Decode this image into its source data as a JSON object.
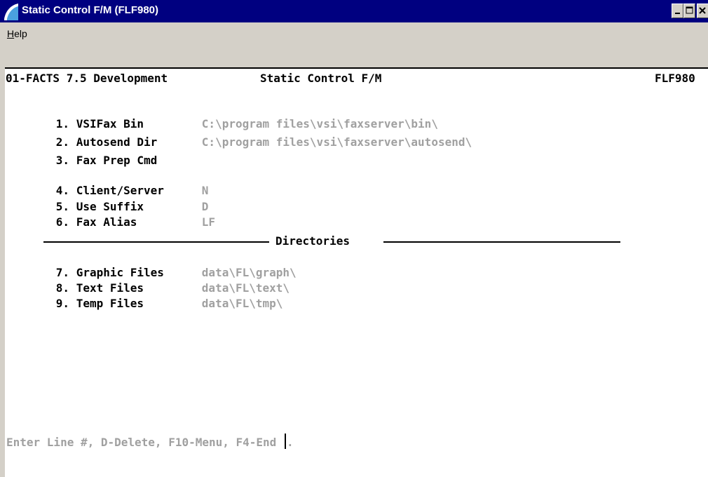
{
  "window": {
    "title": "Static Control F/M (FLF980)",
    "title_bar_color": "#000080",
    "controls": [
      "minimize-icon",
      "maximize-icon",
      "close-icon"
    ]
  },
  "menu": {
    "help_first": "H",
    "help_rest": "elp"
  },
  "header": {
    "company": "01-FACTS 7.5 Development",
    "program": "Static Control F/M",
    "code": "FLF980"
  },
  "fields": [
    {
      "label": "1. VSIFax Bin",
      "value": "C:\\program files\\vsi\\faxserver\\bin\\"
    },
    {
      "label": "2. Autosend Dir",
      "value": "C:\\program files\\vsi\\faxserver\\autosend\\"
    },
    {
      "label": "3. Fax Prep Cmd",
      "value": ""
    },
    {
      "label": "4. Client/Server",
      "value": "N"
    },
    {
      "label": "5. Use Suffix",
      "value": "D"
    },
    {
      "label": "6. Fax Alias",
      "value": "LF"
    }
  ],
  "directories": {
    "heading": "Directories",
    "items": [
      {
        "label": "7. Graphic Files",
        "value": "data\\FL\\graph\\"
      },
      {
        "label": "8. Text Files",
        "value": "data\\FL\\text\\"
      },
      {
        "label": "9. Temp Files",
        "value": "data\\FL\\tmp\\"
      }
    ]
  },
  "prompt": {
    "text": "Enter Line #, D-Delete, F10-Menu, F4-End",
    "suffix": "."
  },
  "colors": {
    "value_gray": "#a0a0a0",
    "window_bg": "#d4d0c8",
    "console_bg": "#ffffff"
  }
}
